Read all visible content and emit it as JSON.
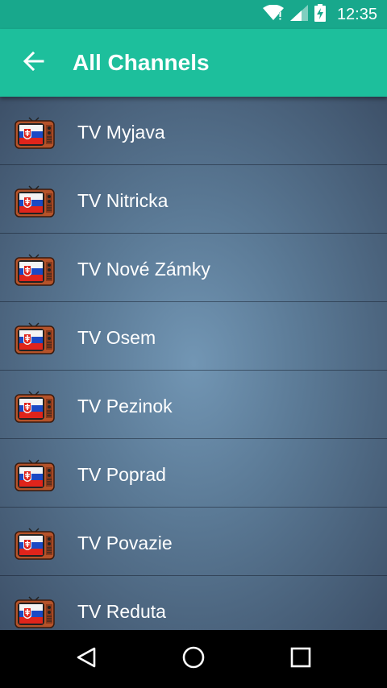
{
  "status_bar": {
    "time": "12:35",
    "icons": [
      "wifi-icon",
      "signal-icon",
      "battery-charging-icon"
    ]
  },
  "app_bar": {
    "back_icon": "arrow-left-icon",
    "title": "All Channels",
    "color": "#1dbf9c"
  },
  "channels": [
    {
      "name": "TV Myjava",
      "icon": "tv-slovakia-flag-icon"
    },
    {
      "name": "TV Nitricka",
      "icon": "tv-slovakia-flag-icon"
    },
    {
      "name": "TV Nové Zámky",
      "icon": "tv-slovakia-flag-icon"
    },
    {
      "name": "TV Osem",
      "icon": "tv-slovakia-flag-icon"
    },
    {
      "name": "TV Pezinok",
      "icon": "tv-slovakia-flag-icon"
    },
    {
      "name": "TV Poprad",
      "icon": "tv-slovakia-flag-icon"
    },
    {
      "name": "TV Povazie",
      "icon": "tv-slovakia-flag-icon"
    },
    {
      "name": "TV Reduta",
      "icon": "tv-slovakia-flag-icon"
    }
  ],
  "nav_bar": {
    "buttons": [
      "back-triangle-icon",
      "home-circle-icon",
      "recents-square-icon"
    ]
  }
}
